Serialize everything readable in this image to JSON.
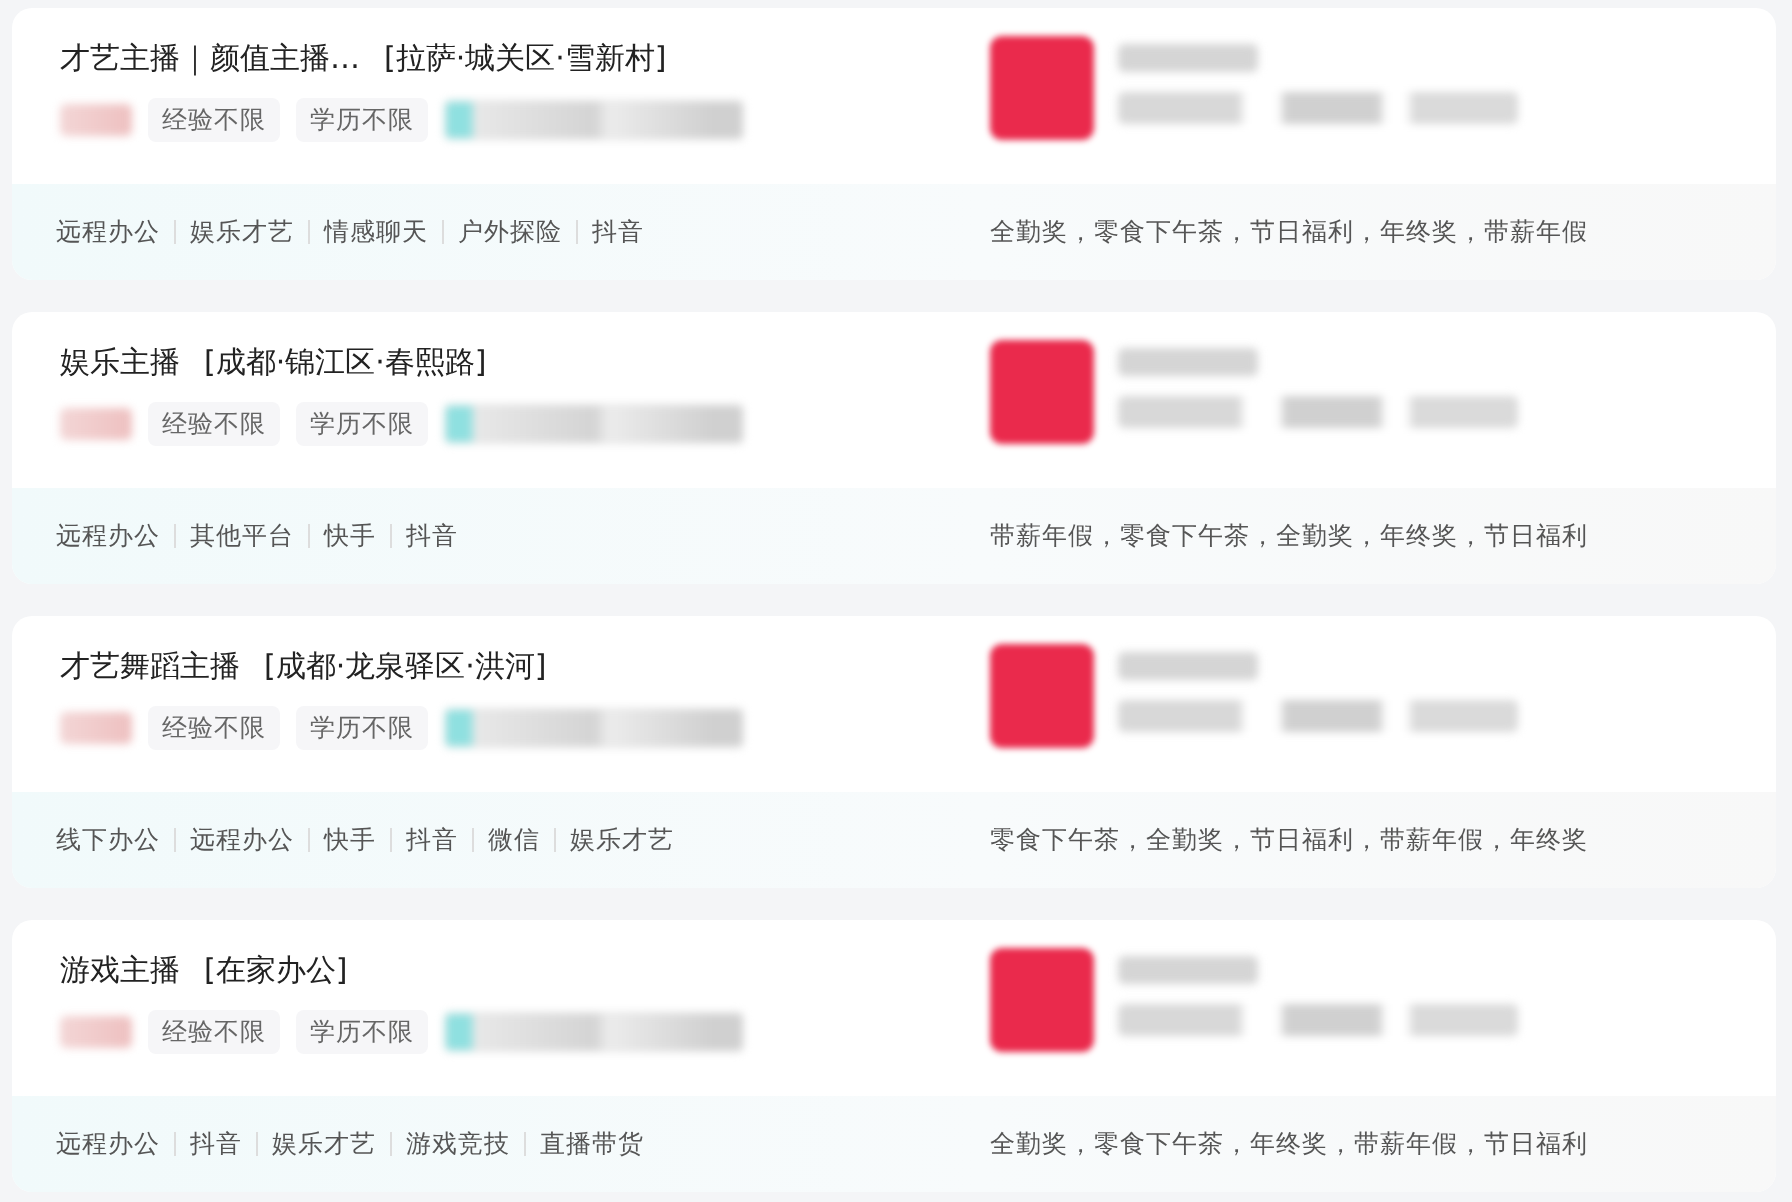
{
  "jobs": [
    {
      "title": "才艺主播｜颜值主播…",
      "location": "[拉萨·城关区·雪新村]",
      "requirements": [
        "经验不限",
        "学历不限"
      ],
      "skills": [
        "远程办公",
        "娱乐才艺",
        "情感聊天",
        "户外探险",
        "抖音"
      ],
      "benefits": "全勤奖，零食下午茶，节日福利，年终奖，带薪年假"
    },
    {
      "title": "娱乐主播",
      "location": "[成都·锦江区·春熙路]",
      "requirements": [
        "经验不限",
        "学历不限"
      ],
      "skills": [
        "远程办公",
        "其他平台",
        "快手",
        "抖音"
      ],
      "benefits": "带薪年假，零食下午茶，全勤奖，年终奖，节日福利"
    },
    {
      "title": "才艺舞蹈主播",
      "location": "[成都·龙泉驿区·洪河]",
      "requirements": [
        "经验不限",
        "学历不限"
      ],
      "skills": [
        "线下办公",
        "远程办公",
        "快手",
        "抖音",
        "微信",
        "娱乐才艺"
      ],
      "benefits": "零食下午茶，全勤奖，节日福利，带薪年假，年终奖"
    },
    {
      "title": "游戏主播",
      "location": "[在家办公]",
      "requirements": [
        "经验不限",
        "学历不限"
      ],
      "skills": [
        "远程办公",
        "抖音",
        "娱乐才艺",
        "游戏竞技",
        "直播带货"
      ],
      "benefits": "全勤奖，零食下午茶，年终奖，带薪年假，节日福利"
    }
  ]
}
